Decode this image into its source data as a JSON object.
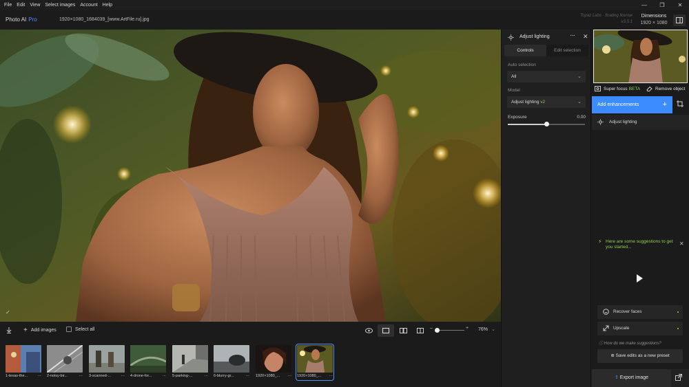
{
  "menu": [
    "File",
    "Edit",
    "View",
    "Select images",
    "Account",
    "Help"
  ],
  "app": {
    "name": "Photo AI",
    "edition": "Pro"
  },
  "file": {
    "name": "1920×1080_1684039_[www.ArtFile.ru].jpg"
  },
  "license": {
    "line1": "Topaz Labs · floating license",
    "line2": "v3.5.1"
  },
  "dimensions": {
    "label": "Dimensions",
    "value": "1920 × 1080"
  },
  "toolbar": {
    "add_images": "Add images",
    "select_all": "Select all",
    "zoom": "76%"
  },
  "thumbnails": [
    {
      "label": "1-texas-the..."
    },
    {
      "label": "2-noisy-bir..."
    },
    {
      "label": "3-scanned-..."
    },
    {
      "label": "4-drone-for..."
    },
    {
      "label": "5-parking-..."
    },
    {
      "label": "6-blurry-gr..."
    },
    {
      "label": "1920×1080_..."
    },
    {
      "label": "1920×1080_..."
    }
  ],
  "controls": {
    "title": "Adjust lighting",
    "tabs": [
      "Controls",
      "Edit selection"
    ],
    "auto_selection_label": "Auto selection",
    "auto_selection_value": "All",
    "model_label": "Model",
    "model_value": "Adjust lighting",
    "model_version": "v2",
    "exposure_label": "Exposure",
    "exposure_value": "0.00",
    "exposure_level": 0.5
  },
  "right": {
    "super_focus": "Super focus",
    "beta": "BETA",
    "remove_object": "Remove object",
    "add_enhancements": "Add enhancements",
    "enhancement_item": "Adjust lighting",
    "suggestion_text": "Here are some suggestions to get you started...",
    "recover_faces": "Recover faces",
    "upscale": "Upscale",
    "how_text": "How do we make suggestions?",
    "save_preset": "Save edits as a new preset",
    "export": "Export image"
  },
  "colors": {
    "accent": "#3d8cff",
    "highlight": "#8fd04a",
    "panel": "#1f1f20"
  }
}
